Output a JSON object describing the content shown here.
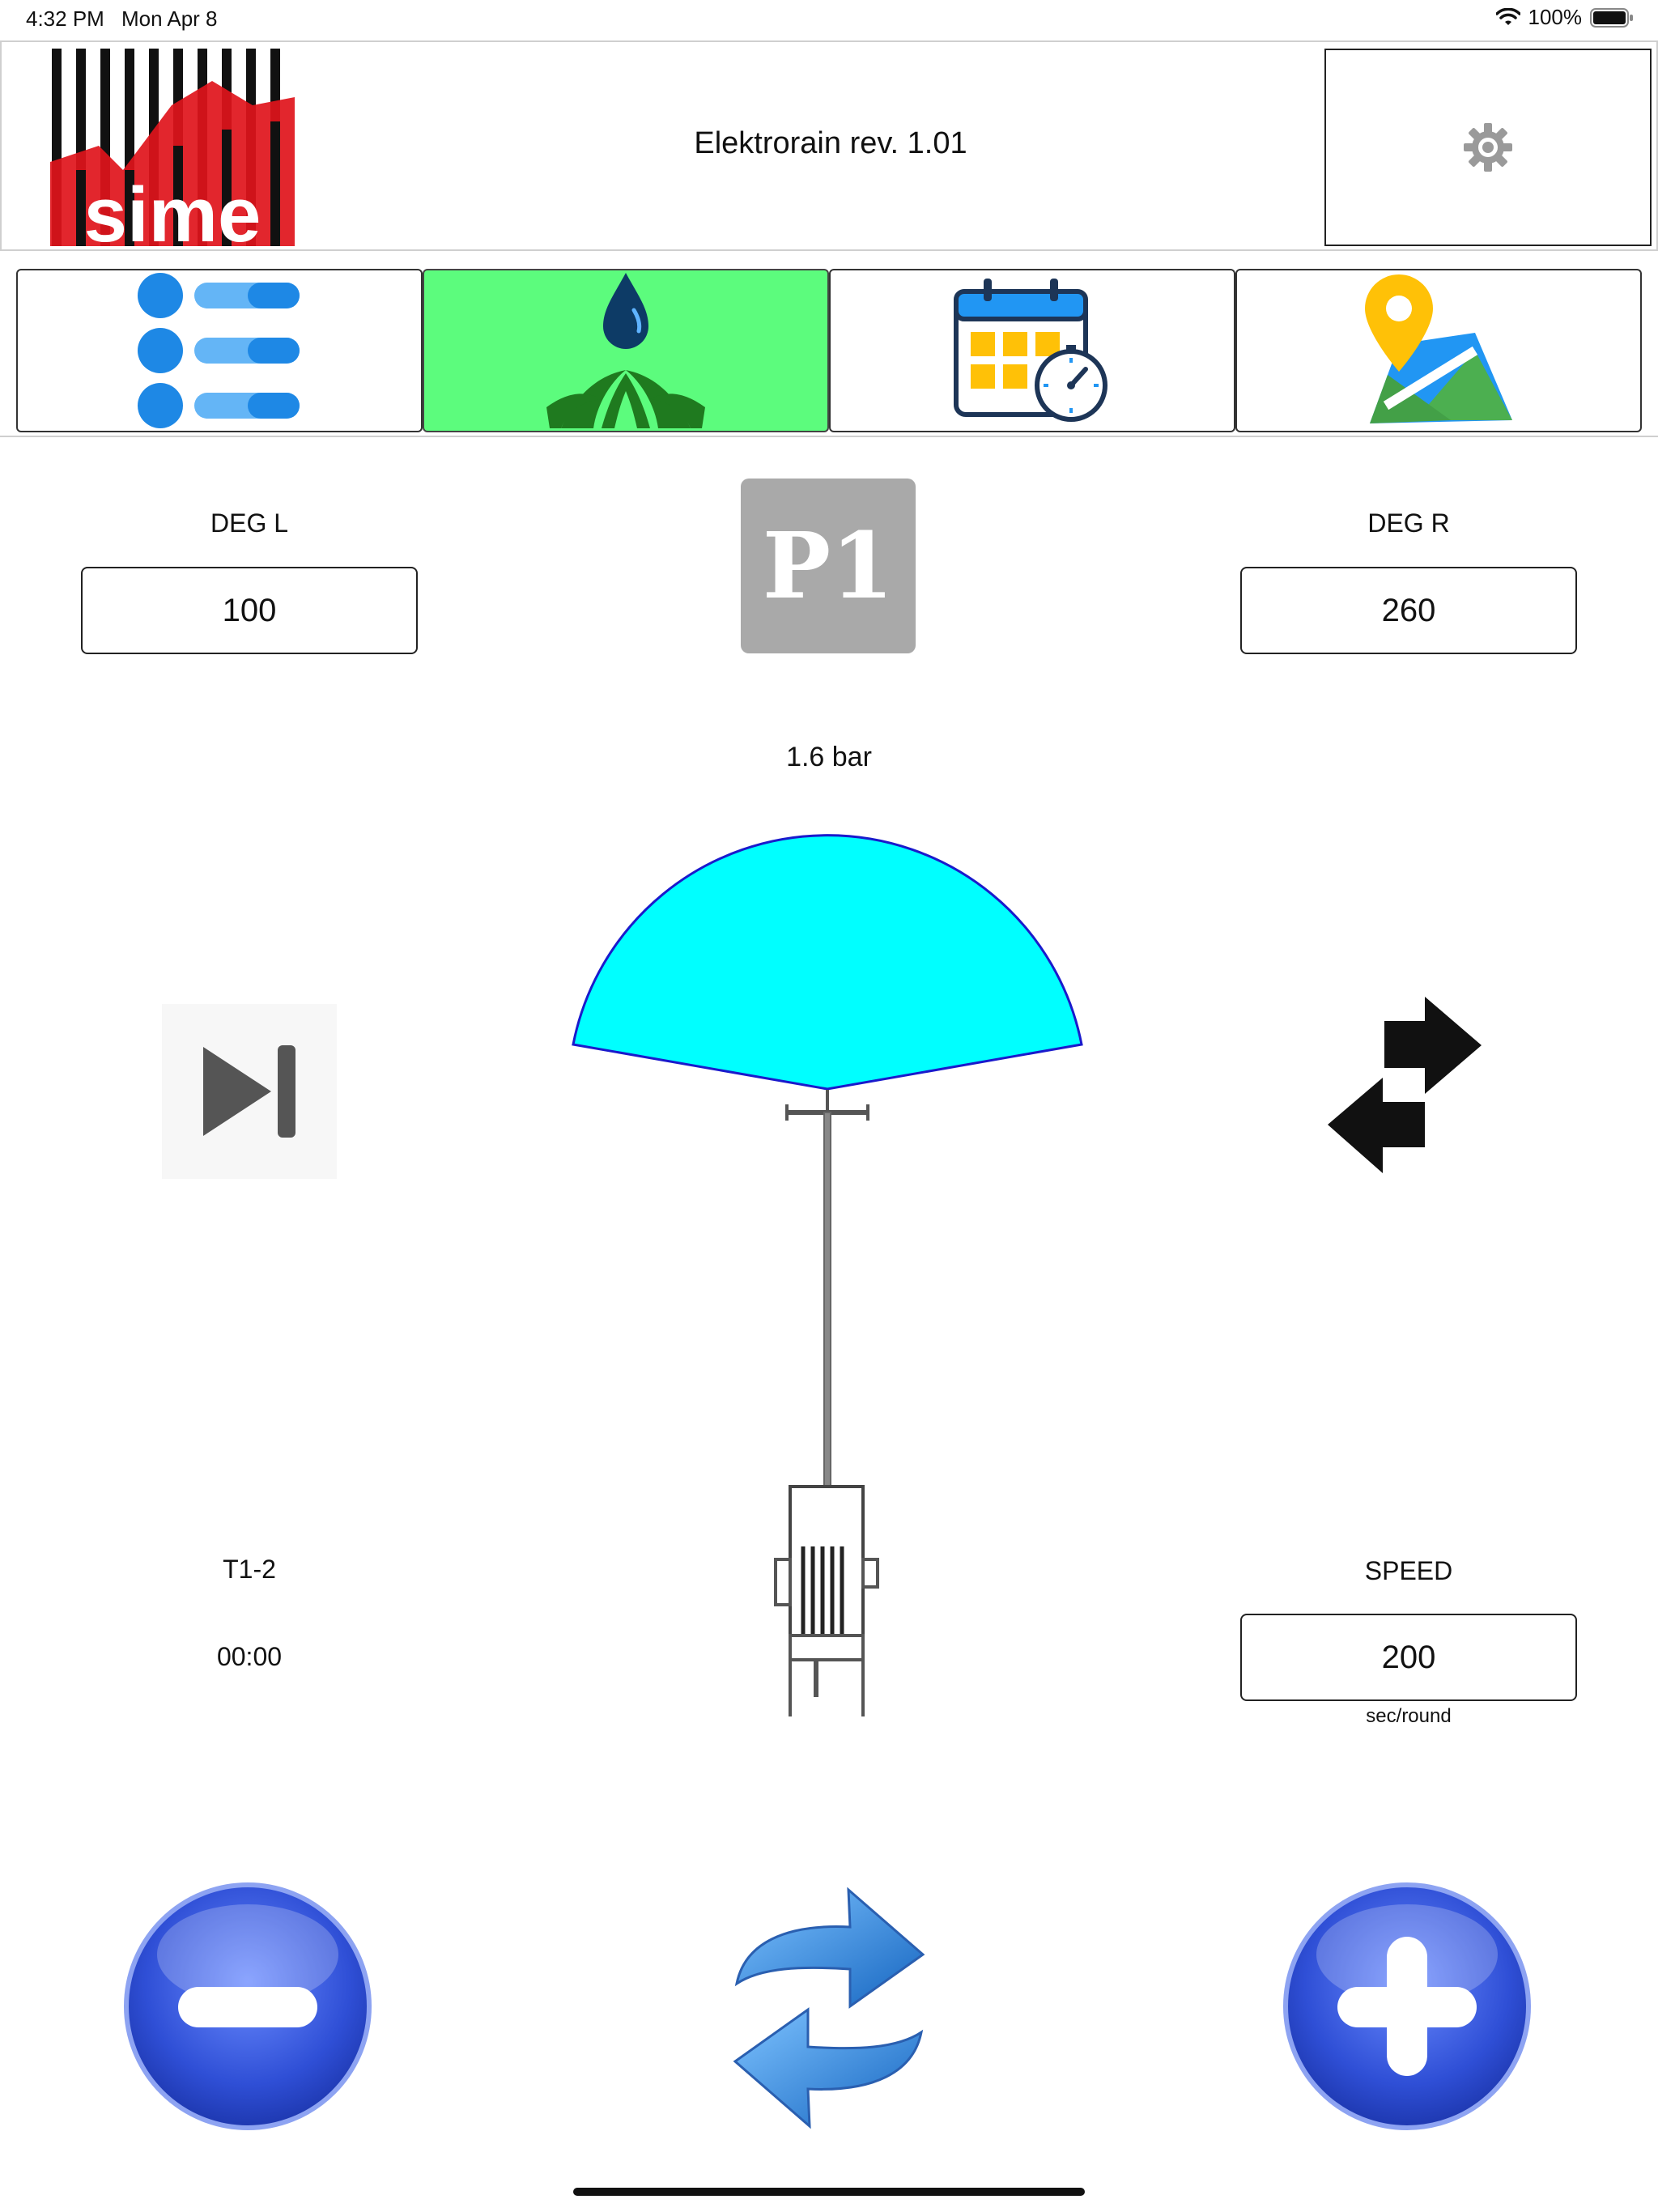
{
  "status_bar": {
    "time": "4:32 PM",
    "date": "Mon Apr 8",
    "battery": "100%"
  },
  "header": {
    "logo_text": "sime",
    "title": "Elektrorain rev. 1.01",
    "settings_icon": "gear-icon"
  },
  "tabs": [
    {
      "icon": "list-icon",
      "active": false
    },
    {
      "icon": "irrigation-drop-icon",
      "active": true
    },
    {
      "icon": "calendar-timer-icon",
      "active": false
    },
    {
      "icon": "map-pin-icon",
      "active": false
    }
  ],
  "controls": {
    "deg_left_label": "DEG L",
    "deg_left_value": "100",
    "program_label": "P1",
    "deg_right_label": "DEG R",
    "deg_right_value": "260",
    "pressure": "1.6 bar",
    "sector_label": "T1-2",
    "timer": "00:00",
    "speed_label": "SPEED",
    "speed_value": "200",
    "speed_unit": "sec/round"
  },
  "colors": {
    "active_tab": "#5cfc7d",
    "spray_fill": "#00ffff",
    "spray_stroke": "#1a1acc",
    "round_button": "#3355dd"
  }
}
